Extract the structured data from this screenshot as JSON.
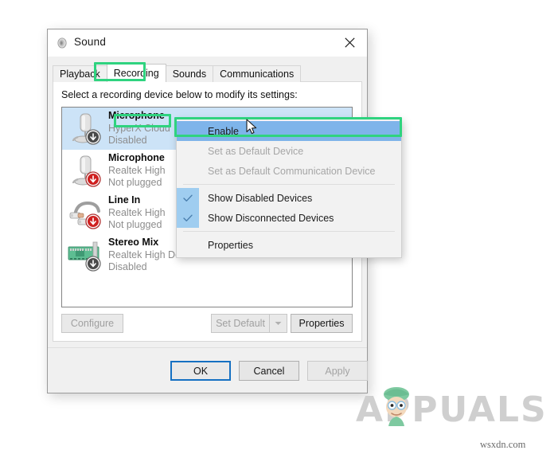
{
  "window": {
    "title": "Sound",
    "icon": "speaker-icon",
    "close_label": "×"
  },
  "tabs": [
    {
      "label": "Playback",
      "active": false
    },
    {
      "label": "Recording",
      "active": true
    },
    {
      "label": "Sounds",
      "active": false
    },
    {
      "label": "Communications",
      "active": false
    }
  ],
  "pane": {
    "instruction": "Select a recording device below to modify its settings:"
  },
  "devices": [
    {
      "name": "Microphone",
      "subtitle": "HyperX Cloud",
      "status": "Disabled",
      "icon": "microphone-icon",
      "badge": "down-arrow-gray-badge",
      "selected": true
    },
    {
      "name": "Microphone",
      "subtitle": "Realtek High",
      "status": "Not plugged",
      "icon": "microphone-icon",
      "badge": "down-arrow-red-badge",
      "selected": false
    },
    {
      "name": "Line In",
      "subtitle": "Realtek High",
      "status": "Not plugged",
      "icon": "rca-cable-icon",
      "badge": "down-arrow-red-badge",
      "selected": false
    },
    {
      "name": "Stereo Mix",
      "subtitle": "Realtek High Definition Audio",
      "status": "Disabled",
      "icon": "sound-card-icon",
      "badge": "down-arrow-gray-badge",
      "selected": false
    }
  ],
  "pane_buttons": {
    "configure": "Configure",
    "set_default": "Set Default",
    "properties": "Properties"
  },
  "footer_buttons": {
    "ok": "OK",
    "cancel": "Cancel",
    "apply": "Apply"
  },
  "context_menu": {
    "items": [
      {
        "label": "Enable",
        "state": "highlighted",
        "checked": false
      },
      {
        "label": "Set as Default Device",
        "state": "disabled",
        "checked": false
      },
      {
        "label": "Set as Default Communication Device",
        "state": "disabled",
        "checked": false
      },
      {
        "label": "Show Disabled Devices",
        "state": "normal",
        "checked": true
      },
      {
        "label": "Show Disconnected Devices",
        "state": "normal",
        "checked": true
      },
      {
        "label": "Properties",
        "state": "normal",
        "checked": false
      }
    ]
  },
  "annotations": {
    "accent_color": "#2fd37f",
    "highlighted": [
      "Recording",
      "Microphone",
      "Enable"
    ]
  },
  "watermark": {
    "logo_text": "APPUALS",
    "source": "wsxdn.com"
  },
  "colors": {
    "selection_blue": "#cce3f7",
    "menu_highlight": "#7eb4ea",
    "ok_focus_border": "#1570c2",
    "green_accent": "#2fd37f"
  }
}
